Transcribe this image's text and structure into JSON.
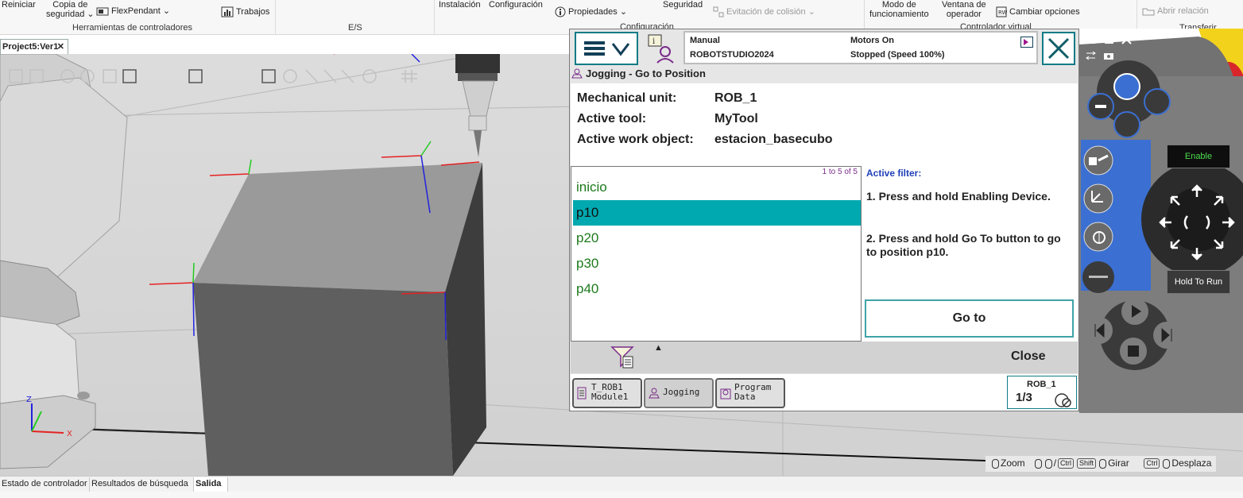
{
  "ribbon": {
    "items": {
      "reiniciar": "Reiniciar",
      "copia": "Copia de",
      "seguridad": "seguridad",
      "flexpendant": "FlexPendant",
      "trabajos": "Trabajos",
      "instalacion": "Instalación",
      "configuracion": "Configuración",
      "propiedades": "Propiedades",
      "seguridad2": "Seguridad",
      "evitacion": "Evitación de colisión",
      "modo_line1": "Modo de",
      "modo_line2": "funcionamiento",
      "ventana_line1": "Ventana de",
      "ventana_line2": "operador",
      "cambiar": "Cambiar opciones",
      "abrir_relacion": "Abrir relación"
    },
    "groups": {
      "herramientas": "Herramientas de controladores",
      "es": "E/S",
      "configuracion": "Configuración",
      "controlador_virtual": "Controlador virtual",
      "transferir": "Transferir"
    }
  },
  "doc_tab": {
    "label": "Project5:Ver1",
    "close": "✕"
  },
  "viewport": {
    "axis_labels": {
      "z": "Z",
      "x": "X"
    },
    "nav_hint": {
      "zoom": "Zoom",
      "ctrl": "Ctrl",
      "shift": "Shift",
      "girar": "Girar",
      "ctrl2": "Ctrl",
      "desplazar": "Desplaza"
    }
  },
  "bottom_tabs": [
    "Estado de controlador",
    "Resultados de búsqueda",
    "Salida"
  ],
  "flexpendant": {
    "status": {
      "mode": "Manual",
      "system": "ROBOTSTUDIO2024",
      "motors": "Motors On",
      "state": "Stopped (Speed 100%)"
    },
    "title": "Jogging - Go to Position",
    "info": {
      "mech_label": "Mechanical unit:",
      "mech_value": "ROB_1",
      "tool_label": "Active tool:",
      "tool_value": "MyTool",
      "wobj_label": "Active work object:",
      "wobj_value": "estacion_basecubo"
    },
    "list": {
      "count": "1 to 5 of 5",
      "items": [
        "inicio",
        "p10",
        "p20",
        "p30",
        "p40"
      ],
      "selected": "p10"
    },
    "filter": {
      "title": "Active filter:",
      "step1": "1. Press and hold Enabling Device.",
      "step2": "2. Press and hold Go To button to go to position p10."
    },
    "goto_label": "Go to",
    "close_label": "Close",
    "taskbar": {
      "t1_line1": "T_ROB1",
      "t1_line2": "Module1",
      "t2": "Jogging",
      "t3_line1": "Program",
      "t3_line2": "Data"
    },
    "rob": {
      "label": "ROB_1",
      "fraction": "1/3"
    }
  },
  "hardware": {
    "enable": "Enable",
    "hold_to_run": "Hold To Run"
  },
  "colors": {
    "accent_teal": "#0e7c86",
    "selected_row": "#00a9b0",
    "list_text": "#1d7a1d",
    "filter_title": "#1f3fb8",
    "controller_blue": "#3b6fd1",
    "emergency_yellow": "#f2d21b",
    "emergency_red": "#d8262a"
  }
}
